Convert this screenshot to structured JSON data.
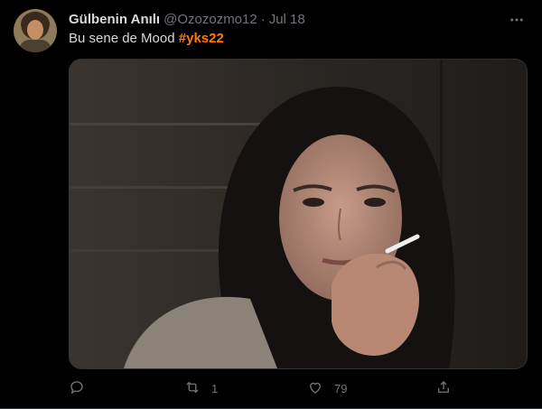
{
  "tweet": {
    "author_name": "Gülbenin Anılı",
    "handle": "@Ozozozmo12",
    "separator": "·",
    "date": "Jul 18",
    "text": "Bu sene de Mood ",
    "hashtag": "#yks22",
    "hashtag_color": "#ff7a00"
  },
  "actions": {
    "reply_count": "",
    "retweet_count": "1",
    "like_count": "79"
  },
  "icons": {
    "more": "more-icon",
    "reply": "reply-icon",
    "retweet": "retweet-icon",
    "like": "like-icon",
    "share": "share-icon"
  },
  "colors": {
    "background": "#000000",
    "text": "#d9d9d9",
    "muted": "#6e767d",
    "border": "#2f3336"
  }
}
